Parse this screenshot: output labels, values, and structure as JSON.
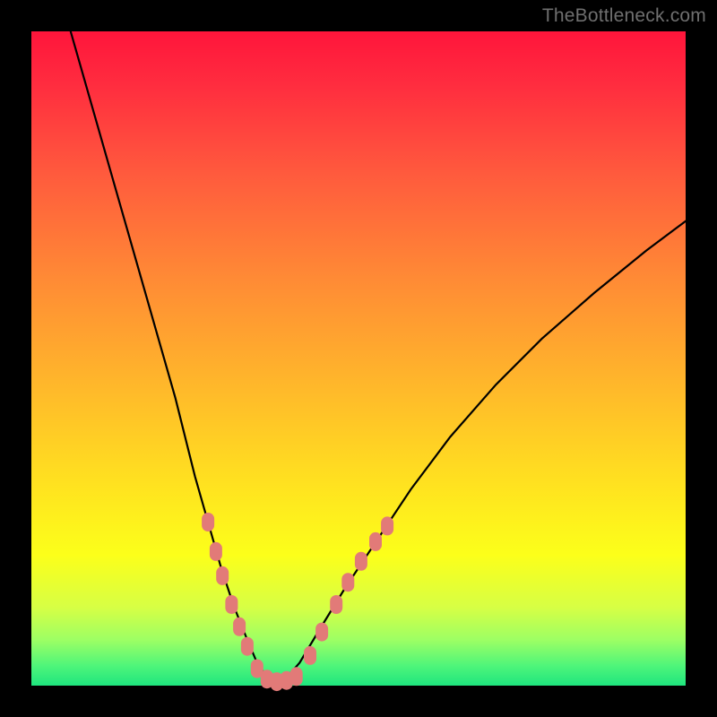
{
  "watermark": "TheBottleneck.com",
  "chart_data": {
    "type": "line",
    "title": "",
    "xlabel": "",
    "ylabel": "",
    "xlim": [
      0,
      100
    ],
    "ylim": [
      0,
      100
    ],
    "grid": false,
    "legend": false,
    "series": [
      {
        "name": "bottleneck-curve",
        "x": [
          6,
          10,
          14,
          18,
          22,
          25,
          27,
          29,
          31,
          33,
          34.5,
          36,
          37.5,
          39,
          41,
          44,
          48,
          53,
          58,
          64,
          71,
          78,
          86,
          94,
          100
        ],
        "y": [
          100,
          86,
          72,
          58,
          44,
          32,
          25,
          18,
          12,
          7,
          3.5,
          1.3,
          0.5,
          1.2,
          3.5,
          8.5,
          15,
          22.5,
          30,
          38,
          46,
          53,
          60,
          66.5,
          71
        ]
      }
    ],
    "markers": {
      "name": "highlight-dots",
      "color": "#e27a78",
      "points": [
        {
          "x": 27.0,
          "y": 25.0
        },
        {
          "x": 28.2,
          "y": 20.5
        },
        {
          "x": 29.2,
          "y": 16.8
        },
        {
          "x": 30.6,
          "y": 12.4
        },
        {
          "x": 31.8,
          "y": 9.0
        },
        {
          "x": 33.0,
          "y": 6.0
        },
        {
          "x": 34.5,
          "y": 2.6
        },
        {
          "x": 36.0,
          "y": 1.0
        },
        {
          "x": 37.5,
          "y": 0.6
        },
        {
          "x": 39.0,
          "y": 0.8
        },
        {
          "x": 40.5,
          "y": 1.4
        },
        {
          "x": 42.6,
          "y": 4.6
        },
        {
          "x": 44.4,
          "y": 8.2
        },
        {
          "x": 46.6,
          "y": 12.4
        },
        {
          "x": 48.4,
          "y": 15.8
        },
        {
          "x": 50.4,
          "y": 19.0
        },
        {
          "x": 52.6,
          "y": 22.0
        },
        {
          "x": 54.4,
          "y": 24.4
        }
      ]
    },
    "background_gradient": {
      "stops": [
        {
          "pos": 0.0,
          "color": "#ff153b"
        },
        {
          "pos": 0.38,
          "color": "#ff8b35"
        },
        {
          "pos": 0.7,
          "color": "#ffe41f"
        },
        {
          "pos": 0.93,
          "color": "#9dff64"
        },
        {
          "pos": 1.0,
          "color": "#1fe57e"
        }
      ]
    }
  }
}
